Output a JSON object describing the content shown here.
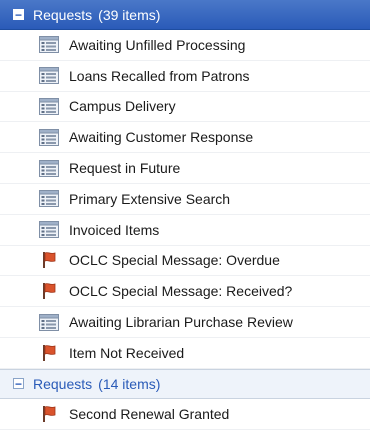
{
  "groups": [
    {
      "label": "Requests",
      "count": "(39 items)",
      "toggle": "−",
      "items": [
        {
          "label": "Awaiting Unfilled Processing",
          "icon": "queue-icon"
        },
        {
          "label": "Loans Recalled from Patrons",
          "icon": "queue-icon"
        },
        {
          "label": "Campus Delivery",
          "icon": "queue-icon"
        },
        {
          "label": "Awaiting Customer Response",
          "icon": "queue-icon"
        },
        {
          "label": "Request in Future",
          "icon": "queue-icon"
        },
        {
          "label": "Primary Extensive Search",
          "icon": "queue-icon"
        },
        {
          "label": "Invoiced Items",
          "icon": "queue-icon"
        },
        {
          "label": "OCLC Special Message: Overdue",
          "icon": "red-flag-icon"
        },
        {
          "label": "OCLC Special Message: Received?",
          "icon": "red-flag-icon"
        },
        {
          "label": "Awaiting Librarian Purchase Review",
          "icon": "queue-icon"
        },
        {
          "label": "Item Not Received",
          "icon": "red-flag-icon"
        }
      ]
    },
    {
      "label": "Requests",
      "count": "(14 items)",
      "toggle": "−",
      "items": [
        {
          "label": "Second Renewal Granted",
          "icon": "red-flag-icon"
        }
      ]
    }
  ],
  "colors": {
    "header_selected": "#2a5bb8",
    "flag": "#d9532c"
  }
}
